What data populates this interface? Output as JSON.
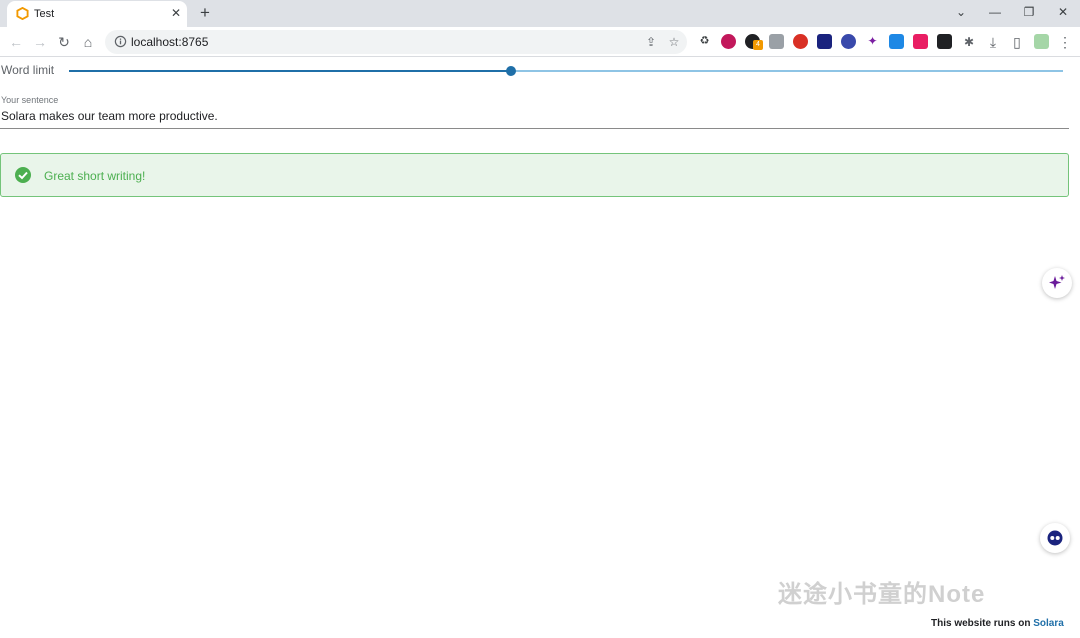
{
  "tab": {
    "title": "Test",
    "close_glyph": "✕",
    "favicon": "solara-hexagon-icon"
  },
  "new_tab_glyph": "+",
  "window": {
    "dropdown": "⌄",
    "minimize": "—",
    "restore": "❐",
    "close": "✕"
  },
  "toolbar": {
    "back": "←",
    "forward": "→",
    "reload": "↻",
    "home": "⌂",
    "url": "localhost:8765",
    "share": "⇪",
    "bookmark": "☆",
    "extensions_puzzle": "✱",
    "download": "⤓",
    "side_panel": "▯",
    "menu": "⋮",
    "ext_badge": "4"
  },
  "slider": {
    "label": "Word limit",
    "value_fraction": 0.445
  },
  "sentence": {
    "label": "Your sentence",
    "value": "Solara makes our team more productive."
  },
  "alert": {
    "text": "Great short writing!",
    "color": "#4caf50"
  },
  "watermark": "迷途小书童的Note",
  "footer": {
    "prefix": "This website runs on",
    "link": "Solara"
  },
  "colors": {
    "accent": "#1f6fa8",
    "track_light": "#8ec4e5",
    "success_bg": "#e9f5ea",
    "success_border": "#74c47a"
  }
}
